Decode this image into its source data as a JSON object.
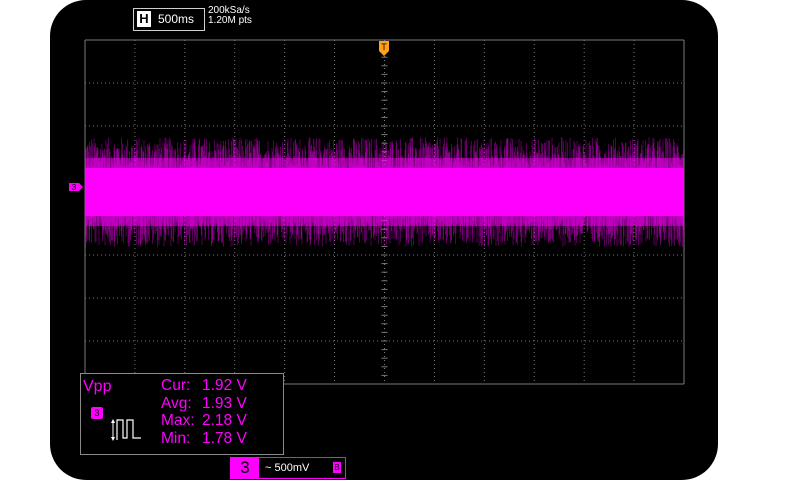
{
  "timebase": {
    "h_label": "H",
    "value": "500ms"
  },
  "acquisition": {
    "sample_rate": "200kSa/s",
    "points": "1.20M pts"
  },
  "trigger": {
    "label": "T"
  },
  "channel_marker": {
    "label": "3"
  },
  "measurement": {
    "name": "Vpp",
    "channel_icon": "3",
    "rows": [
      {
        "label": "Cur:",
        "value": "1.92 V"
      },
      {
        "label": "Avg:",
        "value": "1.93 V"
      },
      {
        "label": "Max:",
        "value": "2.18 V"
      },
      {
        "label": "Min:",
        "value": "1.78 V"
      }
    ]
  },
  "channel": {
    "number": "3",
    "scale": "~ 500mV",
    "bw_icon": "B"
  },
  "colors": {
    "channel3": "#ff00ff",
    "trigger": "#ff9f1a",
    "grid": "#7a7a7a",
    "background": "#000000"
  }
}
